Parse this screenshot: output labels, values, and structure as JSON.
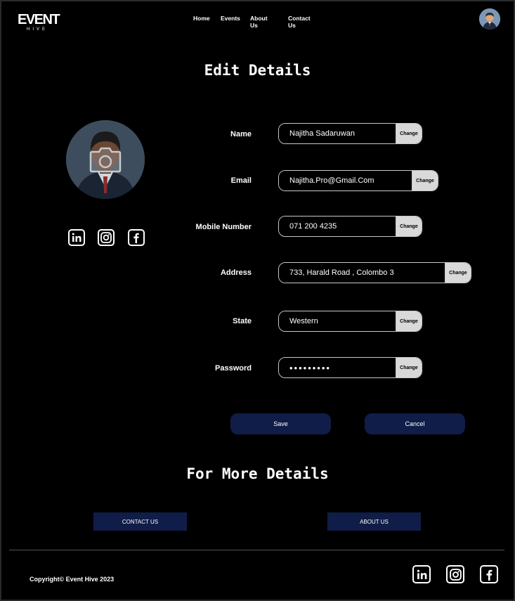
{
  "brand": {
    "name": "EVENT",
    "tagline": "HIVE"
  },
  "nav": [
    "Home",
    "Events",
    "About Us",
    "Contact Us"
  ],
  "page_title": "Edit  Details",
  "fields": [
    {
      "label": "Name",
      "value": "Najitha Sadaruwan",
      "action": "Change"
    },
    {
      "label": "Email",
      "value": "Najitha.Pro@Gmail.Com",
      "action": "Change"
    },
    {
      "label": "Mobile Number",
      "value": "071 200 4235",
      "action": "Change"
    },
    {
      "label": "Address",
      "value": "733, Harald Road , Colombo 3",
      "action": "Change"
    },
    {
      "label": "State",
      "value": "Western",
      "action": "Change"
    },
    {
      "label": "Password",
      "value": "•••••••••",
      "action": "Change"
    }
  ],
  "buttons": {
    "save": "Save",
    "cancel": "Cancel"
  },
  "more_title": "For More Details",
  "more_buttons": {
    "contact": "CONTACT  US",
    "about": "ABOUT US"
  },
  "footer": {
    "copyright": "Copyright© Event Hive 2023"
  },
  "colors": {
    "background": "#000000",
    "button": "#101d48",
    "change_button": "#d9d9d9"
  },
  "icons": [
    "linkedin-icon",
    "instagram-icon",
    "facebook-icon",
    "camera-icon"
  ]
}
